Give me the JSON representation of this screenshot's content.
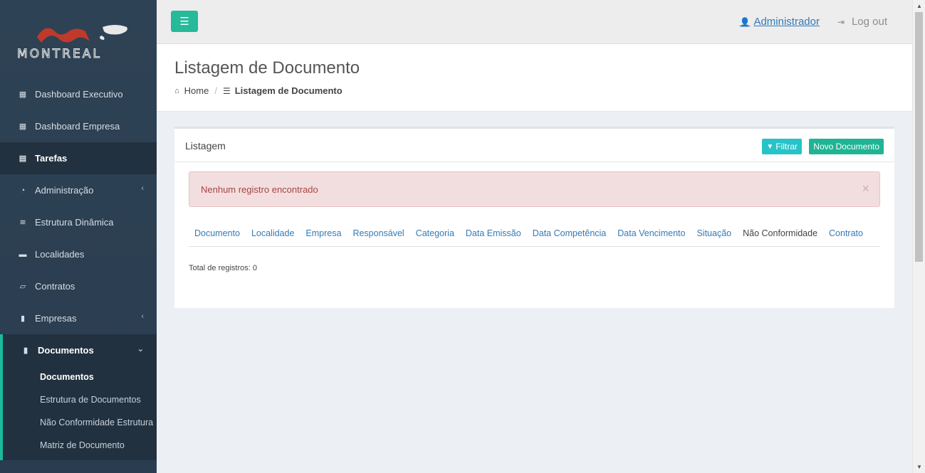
{
  "brand": {
    "logo_text": "MONTREAL"
  },
  "sidebar": {
    "items": [
      {
        "label": "Dashboard Executivo",
        "icon": "grid-icon"
      },
      {
        "label": "Dashboard Empresa",
        "icon": "grid-icon"
      },
      {
        "label": "Tarefas",
        "icon": "tasks-icon"
      },
      {
        "label": "Administração",
        "icon": "dashboard-icon"
      },
      {
        "label": "Estrutura Dinâmica",
        "icon": "database-icon"
      },
      {
        "label": "Localidades",
        "icon": "briefcase-icon"
      },
      {
        "label": "Contratos",
        "icon": "book-icon"
      },
      {
        "label": "Empresas",
        "icon": "file-icon"
      },
      {
        "label": "Documentos",
        "icon": "file-icon"
      }
    ],
    "submenu": [
      "Documentos",
      "Estrutura de Documentos",
      "Não Conformidade Estrutura",
      "Matriz de Documento"
    ]
  },
  "topbar": {
    "user": "Administrador",
    "logout": "Log out"
  },
  "header": {
    "title": "Listagem de Documento",
    "breadcrumb_home": "Home",
    "breadcrumb_current": "Listagem de Documento"
  },
  "panel": {
    "title": "Listagem",
    "filter_label": "Filtrar",
    "new_label": "Novo Documento",
    "alert": "Nenhum registro encontrado",
    "columns": [
      "Documento",
      "Localidade",
      "Empresa",
      "Responsável",
      "Categoria",
      "Data Emissão",
      "Data Competência",
      "Data Vencimento",
      "Situação",
      "Não Conformidade",
      "Contrato"
    ],
    "total": "Total de registros: 0"
  },
  "colors": {
    "accent": "#26b99a",
    "sidebar_bg": "#2a3f54",
    "alert_bg": "#f2dede",
    "link": "#337ab7"
  }
}
